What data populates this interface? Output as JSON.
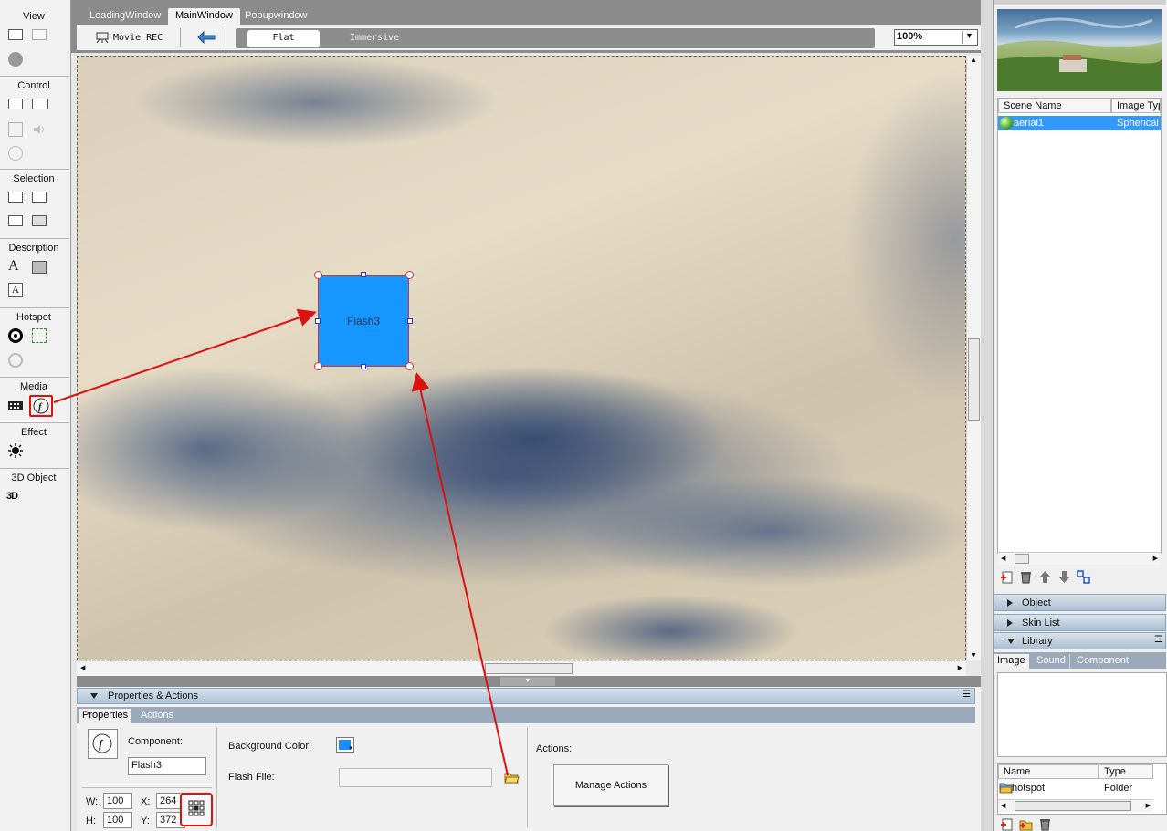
{
  "toolbox": {
    "sections": {
      "view": "View",
      "control": "Control",
      "selection": "Selection",
      "description": "Description",
      "hotspot": "Hotspot",
      "media": "Media",
      "effect": "Effect",
      "object3d": "3D Object"
    }
  },
  "window_tabs": [
    "LoadingWindow",
    "MainWindow",
    "Popupwindow"
  ],
  "active_tab": "MainWindow",
  "toolbar": {
    "movie_rec": "Movie REC",
    "modes": [
      "Flat",
      "Immersive"
    ],
    "active_mode": "Flat",
    "zoom": "100%"
  },
  "canvas": {
    "component_label": "Flash3"
  },
  "properties": {
    "header": "Properties & Actions",
    "tabs": [
      "Properties",
      "Actions"
    ],
    "active_tab": "Properties",
    "component_label": "Component:",
    "component_name": "Flash3",
    "w_label": "W:",
    "w": "100",
    "h_label": "H:",
    "h": "100",
    "x_label": "X:",
    "x": "264",
    "y_label": "Y:",
    "y": "372",
    "bg_color_label": "Background Color:",
    "bg_color": "#1a8cff",
    "flash_file_label": "Flash File:",
    "flash_file": "",
    "actions_label": "Actions:",
    "manage_actions": "Manage Actions"
  },
  "scenes": {
    "columns": [
      "Scene Name",
      "Image Typ"
    ],
    "rows": [
      {
        "name": "aerial1",
        "type": "Spherical"
      }
    ]
  },
  "panels": {
    "object": "Object",
    "skin_list": "Skin List",
    "library": "Library"
  },
  "library": {
    "tabs": [
      "Image",
      "Sound",
      "Component"
    ],
    "active_tab": "Image",
    "columns": [
      "Name",
      "Type"
    ],
    "rows": [
      {
        "name": "hotspot",
        "type": "Folder"
      }
    ]
  },
  "colors": {
    "selection_blue": "#3399ff",
    "annotation_red": "#dd1111",
    "component_fill": "#1597ff"
  }
}
